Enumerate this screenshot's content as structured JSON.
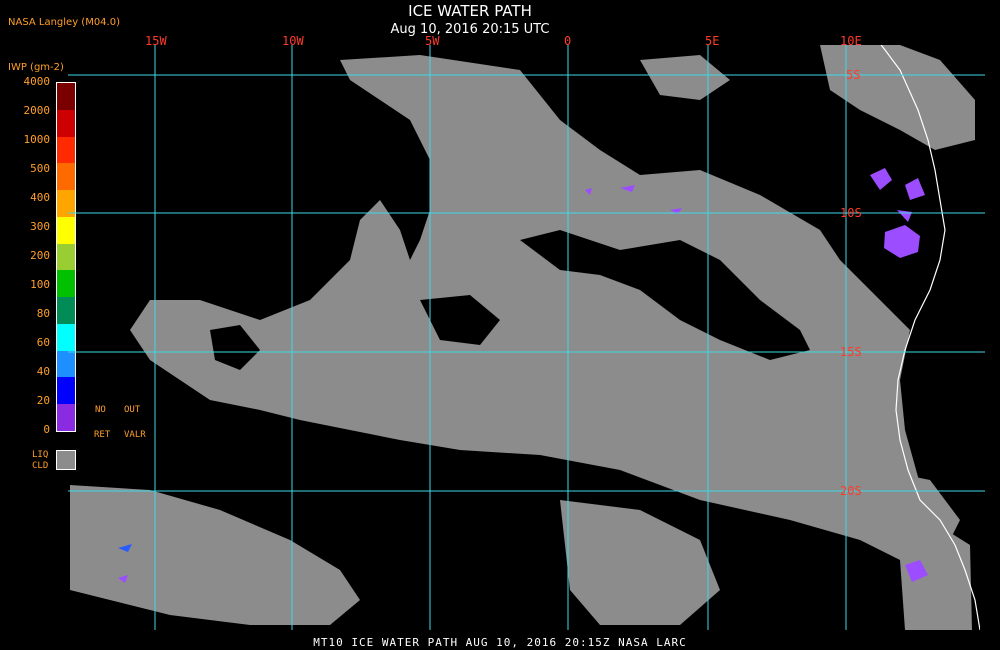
{
  "header": {
    "provider": "NASA Langley (M04.0)",
    "title": "ICE WATER PATH",
    "subtitle": "Aug 10, 2016 20:15 UTC"
  },
  "legend": {
    "unit_label": "IWP (gm-2)",
    "ticks": [
      "4000",
      "2000",
      "1000",
      "500",
      "400",
      "300",
      "200",
      "100",
      "80",
      "60",
      "40",
      "20",
      "0"
    ],
    "colors": [
      "#7a0000",
      "#cc0000",
      "#ff2a00",
      "#ff6a00",
      "#ffa500",
      "#ffff00",
      "#9acd32",
      "#00c000",
      "#008b57",
      "#00ffff",
      "#1e8fff",
      "#0000ff",
      "#8a2be2"
    ],
    "no_ret_line1": "NO",
    "no_ret_line2": "RET",
    "out_valr_line1": "OUT",
    "out_valr_line2": "VALR",
    "liq_line1": "LIQ",
    "liq_line2": "CLD",
    "liq_color": "#8c8c8c"
  },
  "map": {
    "lon_labels": [
      "15W",
      "10W",
      "5W",
      "0",
      "5E",
      "10E"
    ],
    "lat_labels": [
      "5S",
      "10S",
      "15S",
      "20S"
    ],
    "gridline_color": "#40d8e8",
    "ocean_color": "#000000",
    "liquid_cloud_color": "#8c8c8c",
    "ice_cloud_color": "#9b4dff",
    "coastline_color": "#ffffff"
  },
  "footer": {
    "caption": "MT10  ICE WATER PATH   AUG 10, 2016 20:15Z   NASA LARC"
  }
}
